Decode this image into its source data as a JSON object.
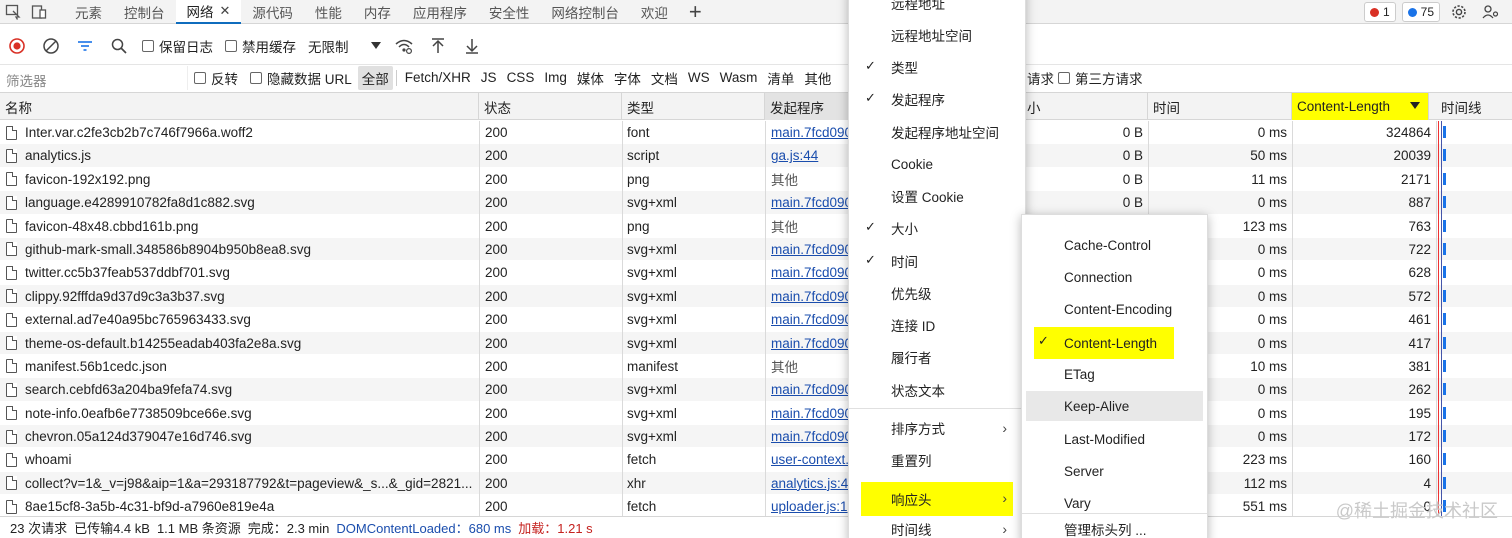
{
  "tabs": {
    "items": [
      {
        "label": "元素"
      },
      {
        "label": "控制台"
      },
      {
        "label": "网络",
        "active": true
      },
      {
        "label": "源代码"
      },
      {
        "label": "性能"
      },
      {
        "label": "内存"
      },
      {
        "label": "应用程序"
      },
      {
        "label": "安全性"
      },
      {
        "label": "网络控制台"
      },
      {
        "label": "欢迎"
      }
    ],
    "close_glyph": "✕",
    "plus_glyph": "+",
    "errors_count": "1",
    "messages_count": "75",
    "colors": {
      "error": "#d93025",
      "info": "#1a73e8"
    }
  },
  "toolbar": {
    "preserve_log": "保留日志",
    "disable_cache": "禁用缓存",
    "throttling": "无限制"
  },
  "filterbar": {
    "placeholder": "筛选器",
    "invert": "反转",
    "hide_data_urls": "隐藏数据 URL",
    "types": [
      "全部",
      "Fetch/XHR",
      "JS",
      "CSS",
      "Img",
      "媒体",
      "字体",
      "文档",
      "WS",
      "Wasm",
      "清单",
      "其他"
    ],
    "blocked_requests_tail": "请求",
    "third_party": "第三方请求"
  },
  "table": {
    "headers": {
      "name": "名称",
      "status": "状态",
      "type": "类型",
      "initiator": "发起程序",
      "size": "小",
      "time": "时间",
      "content_length": "Content-Length",
      "waterfall": "时间线"
    },
    "rows": [
      {
        "name": "Inter.var.c2fe3cb2b7c746f7966a.woff2",
        "status": "200",
        "type": "font",
        "initiator": "main.7fcd090",
        "initiator_link": true,
        "size": "0 B",
        "time": "0 ms",
        "content_length": "324864"
      },
      {
        "name": "analytics.js",
        "status": "200",
        "type": "script",
        "initiator": "ga.js:44",
        "initiator_link": true,
        "size": "0 B",
        "time": "50 ms",
        "content_length": "20039"
      },
      {
        "name": "favicon-192x192.png",
        "status": "200",
        "type": "png",
        "initiator": "其他",
        "initiator_link": false,
        "size": "0 B",
        "time": "11 ms",
        "content_length": "2171"
      },
      {
        "name": "language.e4289910782fa8d1c882.svg",
        "status": "200",
        "type": "svg+xml",
        "initiator": "main.7fcd090",
        "initiator_link": true,
        "size": "0 B",
        "time": "0 ms",
        "content_length": "887"
      },
      {
        "name": "favicon-48x48.cbbd161b.png",
        "status": "200",
        "type": "png",
        "initiator": "其他",
        "initiator_link": false,
        "size": "",
        "time": "123 ms",
        "content_length": "763"
      },
      {
        "name": "github-mark-small.348586b8904b950b8ea8.svg",
        "status": "200",
        "type": "svg+xml",
        "initiator": "main.7fcd090",
        "initiator_link": true,
        "size": "",
        "time": "0 ms",
        "content_length": "722"
      },
      {
        "name": "twitter.cc5b37feab537ddbf701.svg",
        "status": "200",
        "type": "svg+xml",
        "initiator": "main.7fcd090",
        "initiator_link": true,
        "size": "",
        "time": "0 ms",
        "content_length": "628"
      },
      {
        "name": "clippy.92fffda9d37d9c3a3b37.svg",
        "status": "200",
        "type": "svg+xml",
        "initiator": "main.7fcd090",
        "initiator_link": true,
        "size": "",
        "time": "0 ms",
        "content_length": "572"
      },
      {
        "name": "external.ad7e40a95bc765963433.svg",
        "status": "200",
        "type": "svg+xml",
        "initiator": "main.7fcd090",
        "initiator_link": true,
        "size": "",
        "time": "0 ms",
        "content_length": "461"
      },
      {
        "name": "theme-os-default.b14255eadab403fa2e8a.svg",
        "status": "200",
        "type": "svg+xml",
        "initiator": "main.7fcd090",
        "initiator_link": true,
        "size": "",
        "time": "0 ms",
        "content_length": "417"
      },
      {
        "name": "manifest.56b1cedc.json",
        "status": "200",
        "type": "manifest",
        "initiator": "其他",
        "initiator_link": false,
        "size": "",
        "time": "10 ms",
        "content_length": "381"
      },
      {
        "name": "search.cebfd63a204ba9fefa74.svg",
        "status": "200",
        "type": "svg+xml",
        "initiator": "main.7fcd090",
        "initiator_link": true,
        "size": "",
        "time": "0 ms",
        "content_length": "262"
      },
      {
        "name": "note-info.0eafb6e7738509bce66e.svg",
        "status": "200",
        "type": "svg+xml",
        "initiator": "main.7fcd090",
        "initiator_link": true,
        "size": "",
        "time": "0 ms",
        "content_length": "195"
      },
      {
        "name": "chevron.05a124d379047e16d746.svg",
        "status": "200",
        "type": "svg+xml",
        "initiator": "main.7fcd090",
        "initiator_link": true,
        "size": "",
        "time": "0 ms",
        "content_length": "172"
      },
      {
        "name": "whoami",
        "status": "200",
        "type": "fetch",
        "initiator": "user-context.",
        "initiator_link": true,
        "size": "",
        "time": "223 ms",
        "content_length": "160"
      },
      {
        "name": "collect?v=1&_v=j98&aip=1&a=293187792&t=pageview&_s...&_gid=2821...",
        "status": "200",
        "type": "xhr",
        "initiator": "analytics.js:43",
        "initiator_link": true,
        "size": "",
        "time": "112 ms",
        "content_length": "4"
      },
      {
        "name": "8ae15cf8-3a5b-4c31-bf9d-a7960e819e4a",
        "status": "200",
        "type": "fetch",
        "initiator": "uploader.js:1",
        "initiator_link": true,
        "size": "",
        "time": "551 ms",
        "content_length": "0"
      }
    ]
  },
  "statusbar": {
    "requests": "23 次请求",
    "transferred": "已传输4.4 kB",
    "resources": "1.1 MB 条资源",
    "finish": "完成：2.3 min",
    "dom_loaded": "DOMContentLoaded：680 ms",
    "load": "加载：1.21 s",
    "watermark": "@稀土掘金技术社区"
  },
  "menu_main": {
    "items": [
      {
        "label": "远程地址",
        "checked": false
      },
      {
        "label": "远程地址空间",
        "checked": false
      },
      {
        "label": "类型",
        "checked": true
      },
      {
        "label": "发起程序",
        "checked": true
      },
      {
        "label": "发起程序地址空间",
        "checked": false
      },
      {
        "label": "Cookie",
        "checked": false
      },
      {
        "label": "设置 Cookie",
        "checked": false
      },
      {
        "label": "大小",
        "checked": true
      },
      {
        "label": "时间",
        "checked": true
      },
      {
        "label": "优先级",
        "checked": false
      },
      {
        "label": "连接 ID",
        "checked": false
      },
      {
        "label": "履行者",
        "checked": false
      },
      {
        "label": "状态文本",
        "checked": false
      }
    ],
    "sub_items": [
      {
        "label": "排序方式"
      },
      {
        "label": "重置列"
      },
      {
        "label": "响应头"
      },
      {
        "label": "时间线"
      }
    ],
    "check_glyph": "✓",
    "chevron_glyph": "›"
  },
  "menu_headers": {
    "items": [
      {
        "label": "Cache-Control",
        "checked": false
      },
      {
        "label": "Connection",
        "checked": false
      },
      {
        "label": "Content-Encoding",
        "checked": false
      },
      {
        "label": "Content-Length",
        "checked": true
      },
      {
        "label": "ETag",
        "checked": false
      },
      {
        "label": "Keep-Alive",
        "checked": false
      },
      {
        "label": "Last-Modified",
        "checked": false
      },
      {
        "label": "Server",
        "checked": false
      },
      {
        "label": "Vary",
        "checked": false
      }
    ],
    "manage": "管理标头列 ..."
  },
  "colors": {
    "highlight": "#ffff00",
    "link": "#1a4dad",
    "accent": "#0f6cbd",
    "record": "#d93025"
  }
}
